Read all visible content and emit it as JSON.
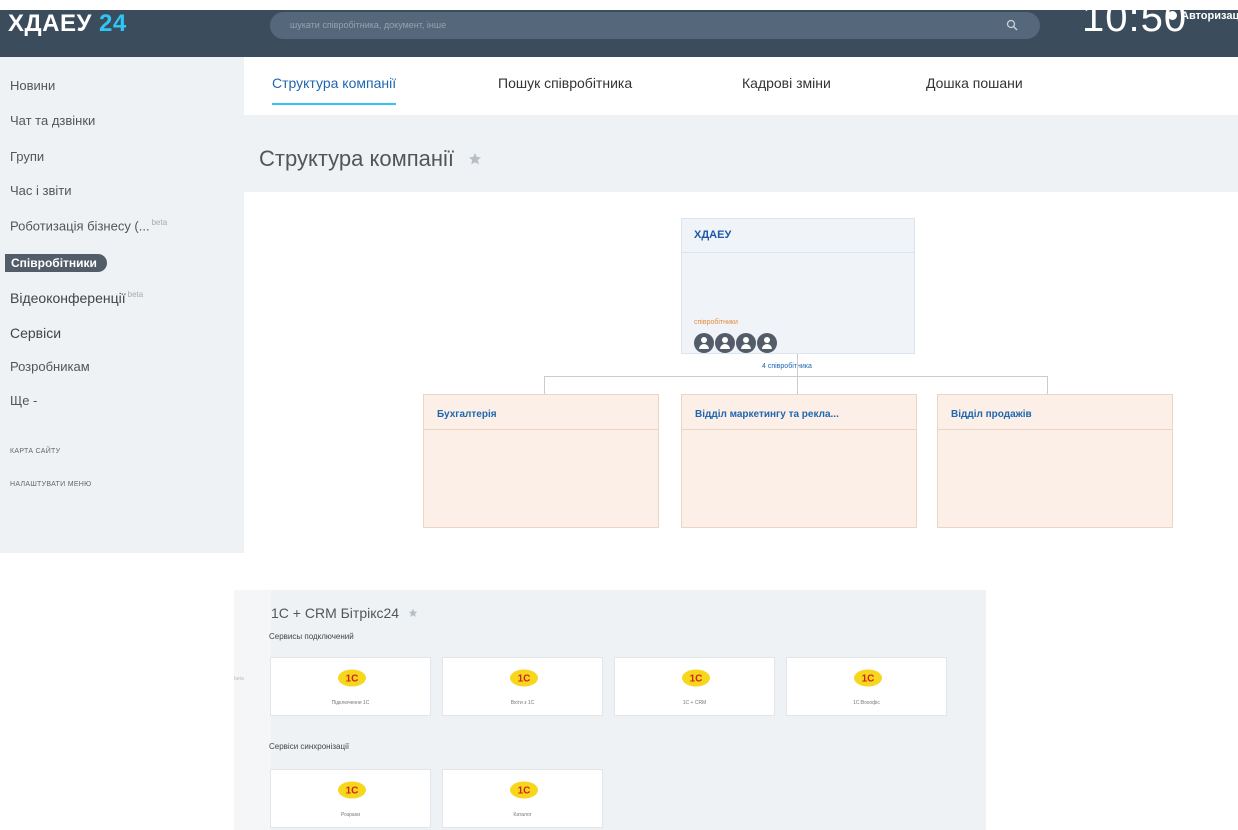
{
  "header": {
    "logo": "ХДАЕУ",
    "logo_accent": "24",
    "search_placeholder": "шукати співробітника, документ, інше",
    "clock": "10:50",
    "auth": "Авторизація"
  },
  "sidebar": {
    "items": [
      {
        "label": "Новини"
      },
      {
        "label": "Чат та дзвінки"
      },
      {
        "label": "Групи"
      },
      {
        "label": "Час і звіти"
      },
      {
        "label": "Роботизація бізнесу (...",
        "badge": "beta"
      },
      {
        "label": "Співробітники",
        "active": true
      },
      {
        "label": "Відеоконференції",
        "badge": "beta"
      },
      {
        "label": "Сервіси"
      },
      {
        "label": "Розробникам"
      },
      {
        "label": "Ще -"
      }
    ],
    "sitemap": "КАРТА САЙТУ",
    "configure_menu": "НАЛАШТУВАТИ МЕНЮ"
  },
  "tabs": [
    {
      "label": "Структура компанії",
      "active": true
    },
    {
      "label": "Пошук співробітника"
    },
    {
      "label": "Кадрові зміни"
    },
    {
      "label": "Дошка пошани"
    }
  ],
  "page_title": "Структура компанії",
  "org": {
    "root": {
      "title": "ХДАЕУ",
      "role": "співробітники",
      "employee_count": "4 співробітника",
      "avatar_count": 4
    },
    "departments": [
      {
        "title": "Бухгалтерія"
      },
      {
        "title": "Відділ маркетингу та рекла..."
      },
      {
        "title": "Відділ продажів"
      }
    ]
  },
  "integration": {
    "title": "1С + CRM Бітрікс24",
    "left_badge": "beta",
    "sections": [
      {
        "title": "Сервисы подключений",
        "cards": [
          {
            "label": "Підключення 1С"
          },
          {
            "label": "Вхіти з 1С"
          },
          {
            "label": "1С + CRM"
          },
          {
            "label": "1С:Вохофіс"
          }
        ]
      },
      {
        "title": "Сервіси синхронізації",
        "cards": [
          {
            "label": "Розрахи"
          },
          {
            "label": "Каталог"
          }
        ]
      }
    ],
    "logo_text": "1С",
    "logo_color": "#f7d71c",
    "logo_text_color": "#d4201f"
  },
  "colors": {
    "topbar": "#3b4d5d",
    "accent": "#2fc6f6",
    "sidebar_bg": "#eef2f4",
    "link": "#2067b0",
    "dept_bg": "#fbefe7"
  }
}
